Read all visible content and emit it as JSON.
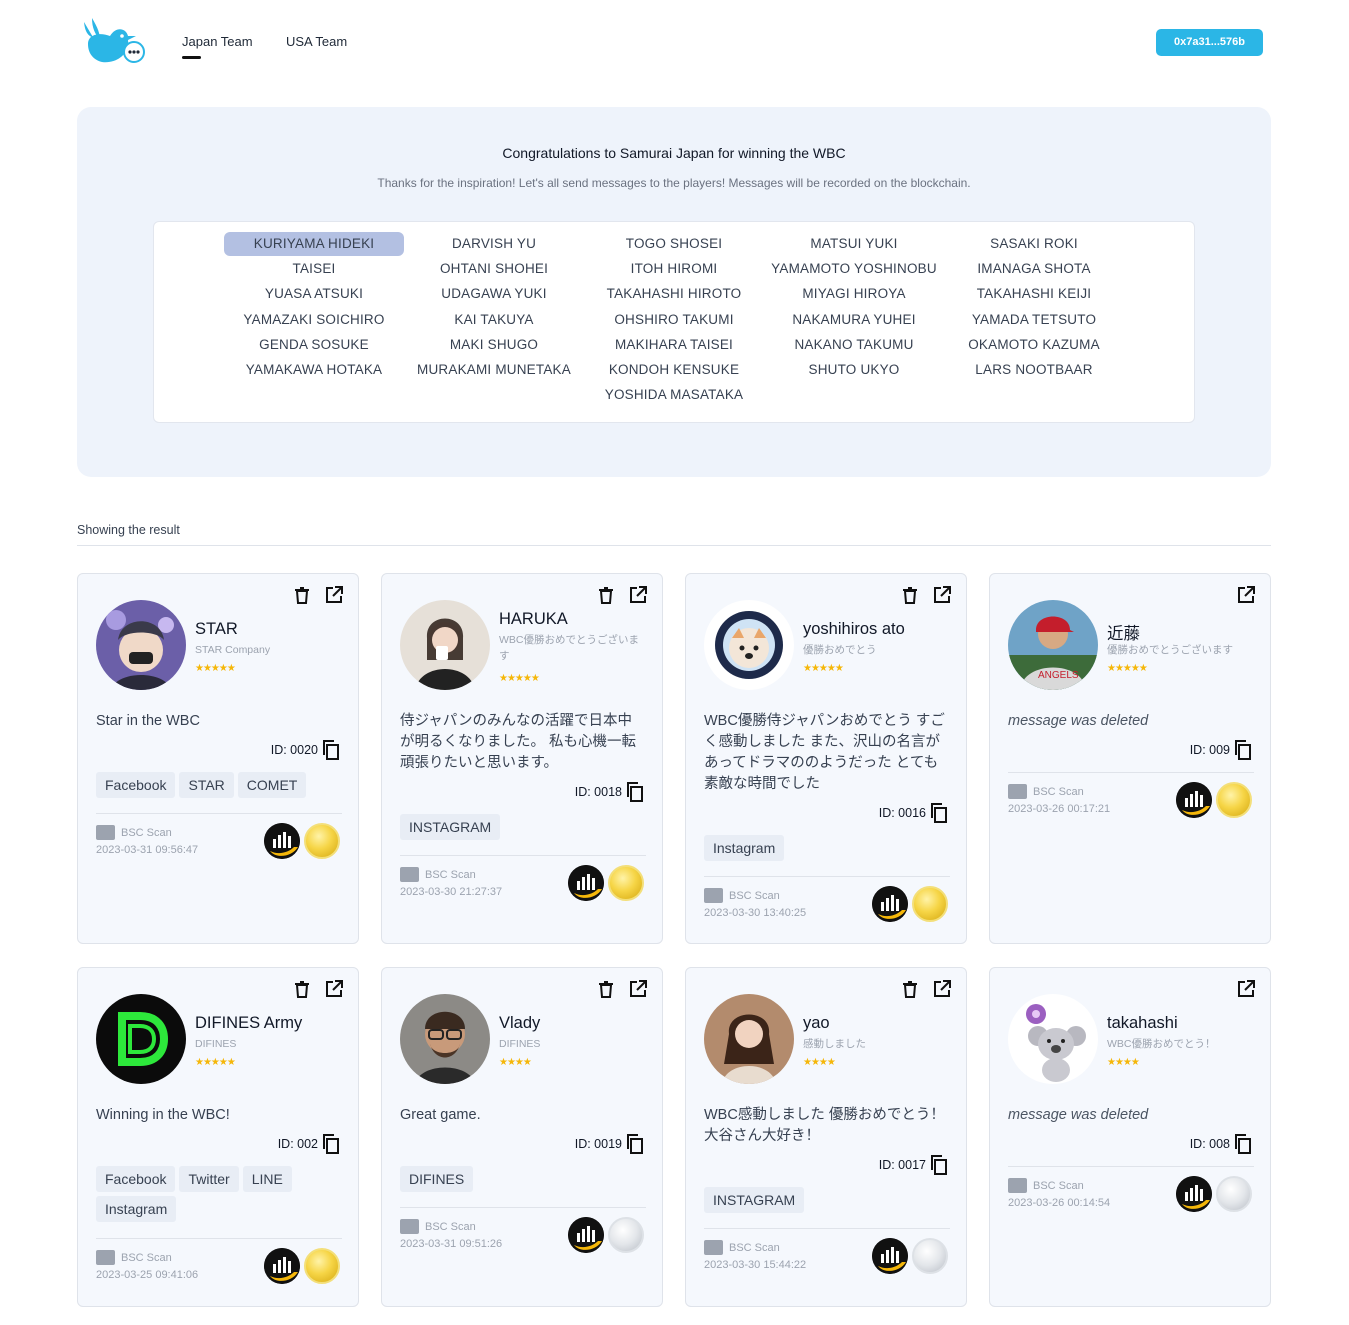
{
  "header": {
    "tabs": [
      {
        "label": "Japan Team",
        "active": true
      },
      {
        "label": "USA Team",
        "active": false
      }
    ],
    "wallet": "0x7a31...576b"
  },
  "hero": {
    "title": "Congratulations to Samurai Japan for winning the WBC",
    "subtitle": "Thanks for the inspiration! Let's all send messages to the players! Messages will be recorded on the blockchain.",
    "players": [
      [
        "KURIYAMA HIDEKI",
        "TAISEI",
        "YUASA ATSUKI",
        "YAMAZAKI SOICHIRO",
        "GENDA SOSUKE",
        "YAMAKAWA HOTAKA"
      ],
      [
        "DARVISH YU",
        "OHTANI SHOHEI",
        "UDAGAWA YUKI",
        "KAI TAKUYA",
        "MAKI SHUGO",
        "MURAKAMI MUNETAKA"
      ],
      [
        "TOGO SHOSEI",
        "ITOH HIROMI",
        "TAKAHASHI HIROTO",
        "OHSHIRO TAKUMI",
        "MAKIHARA TAISEI",
        "KONDOH KENSUKE",
        "YOSHIDA MASATAKA"
      ],
      [
        "MATSUI YUKI",
        "YAMAMOTO YOSHINOBU",
        "MIYAGI HIROYA",
        "NAKAMURA YUHEI",
        "NAKANO TAKUMU",
        "SHUTO UKYO"
      ],
      [
        "SASAKI ROKI",
        "IMANAGA SHOTA",
        "TAKAHASHI KEIJI",
        "YAMADA TETSUTO",
        "OKAMOTO KAZUMA",
        "LARS NOOTBAAR"
      ]
    ],
    "selected_player": "KURIYAMA HIDEKI"
  },
  "result_label": "Showing the result",
  "scan_label": "BSC Scan",
  "cards": [
    {
      "name": "STAR",
      "company": "STAR Company",
      "stars": "★★★★★",
      "message": "Star in the WBC",
      "deleted": false,
      "id": "ID: 0020",
      "tags": [
        "Facebook",
        "STAR",
        "COMET"
      ],
      "date": "2023-03-31 09:56:47",
      "coin": "gold",
      "can_delete": true
    },
    {
      "name": "HARUKA",
      "company": "WBC優勝おめでとうございます",
      "stars": "★★★★★",
      "message": "侍ジャパンのみんなの活躍で日本中が明るくなりました。 私も心機一転頑張りたいと思います。",
      "deleted": false,
      "id": "ID: 0018",
      "tags": [
        "INSTAGRAM"
      ],
      "date": "2023-03-30 21:27:37",
      "coin": "gold",
      "can_delete": true
    },
    {
      "name": "yoshihiros ato",
      "company": "優勝おめでとう",
      "stars": "★★★★★",
      "message": "WBC優勝侍ジャパンおめでとう すごく感動しました また、沢山の名言があってドラマののようだった とても素敵な時間でした",
      "deleted": false,
      "id": "ID: 0016",
      "tags": [
        "Instagram"
      ],
      "date": "2023-03-30 13:40:25",
      "coin": "gold",
      "can_delete": true
    },
    {
      "name": "近藤",
      "company": "優勝おめでとうございます",
      "stars": "★★★★★",
      "message": "message was deleted",
      "deleted": true,
      "id": "ID: 009",
      "tags": [],
      "date": "2023-03-26 00:17:21",
      "coin": "gold",
      "can_delete": false
    },
    {
      "name": "DIFINES Army",
      "company": "DIFINES",
      "stars": "★★★★★",
      "message": "Winning in the WBC!",
      "deleted": false,
      "id": "ID: 002",
      "tags": [
        "Facebook",
        "Twitter",
        "LINE",
        "Instagram"
      ],
      "date": "2023-03-25 09:41:06",
      "coin": "gold",
      "can_delete": true
    },
    {
      "name": "Vlady",
      "company": "DIFINES",
      "stars": "★★★★",
      "message": "Great game.",
      "deleted": false,
      "id": "ID: 0019",
      "tags": [
        "DIFINES"
      ],
      "date": "2023-03-31 09:51:26",
      "coin": "silver",
      "can_delete": true
    },
    {
      "name": "yao",
      "company": "感動しました",
      "stars": "★★★★",
      "message": "WBC感動しました 優勝おめでとう！大谷さん大好き！",
      "deleted": false,
      "id": "ID: 0017",
      "tags": [
        "INSTAGRAM"
      ],
      "date": "2023-03-30 15:44:22",
      "coin": "silver",
      "can_delete": true
    },
    {
      "name": "takahashi",
      "company": "WBC優勝おめでとう！",
      "stars": "★★★★",
      "message": "message was deleted",
      "deleted": true,
      "id": "ID: 008",
      "tags": [],
      "date": "2023-03-26 00:14:54",
      "coin": "silver",
      "can_delete": false
    }
  ],
  "colors": {
    "accent": "#2bb6e6",
    "hero_bg": "#eef3fb",
    "selected": "#b3c0e2",
    "star": "#f5b70a"
  }
}
